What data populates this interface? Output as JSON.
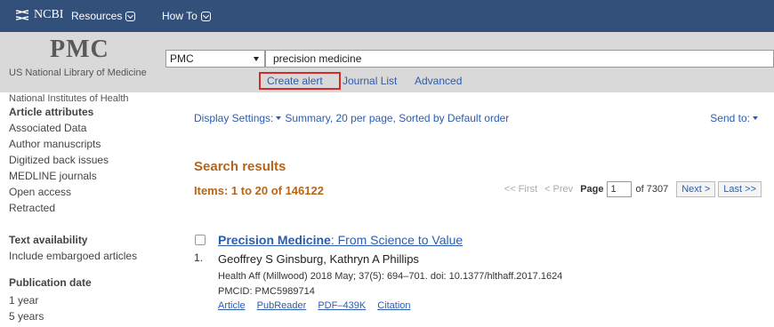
{
  "ncbi_bar": {
    "logo_text": "NCBI",
    "menu": [
      {
        "label": "Resources"
      },
      {
        "label": "How To"
      }
    ]
  },
  "header": {
    "logo": "PMC",
    "library_name": "US National Library of Medicine",
    "institute": "National Institutes of Health",
    "database_select": "PMC",
    "search_value": "precision medicine",
    "links": {
      "create_alert": "Create alert",
      "journal_list": "Journal List",
      "advanced": "Advanced"
    }
  },
  "sidebar": {
    "article_attributes": {
      "heading": "Article attributes",
      "items": [
        "Associated Data",
        "Author manuscripts",
        "Digitized back issues",
        "MEDLINE journals",
        "Open access",
        "Retracted"
      ]
    },
    "text_availability": {
      "heading": "Text availability",
      "items": [
        "Include embargoed articles"
      ]
    },
    "publication_date": {
      "heading": "Publication date",
      "items": [
        "1 year",
        "5 years"
      ]
    }
  },
  "main": {
    "display_settings_label": "Display Settings:",
    "display_settings_value": "Summary, 20 per page, Sorted by Default order",
    "send_to": "Send to:",
    "search_results_heading": "Search results",
    "items_count": "Items: 1 to 20 of 146122",
    "pager": {
      "first": "<< First",
      "prev": "< Prev",
      "page_label": "Page",
      "page_value": "1",
      "of_total": "of 7307",
      "next": "Next >",
      "last": "Last >>"
    },
    "results": [
      {
        "number": "1.",
        "title_highlight": "Precision Medicine",
        "title_rest": ": From Science to Value",
        "authors": "Geoffrey S Ginsburg, Kathryn A Phillips",
        "citation": "Health Aff (Millwood) 2018 May; 37(5): 694–701. doi: 10.1377/hlthaff.2017.1624",
        "pmcid": "PMCID: PMC5989714",
        "links": [
          "Article",
          "PubReader",
          "PDF–439K",
          "Citation"
        ]
      }
    ]
  },
  "colors": {
    "ncbi_bar": "#32507a",
    "header_bg": "#d9d9d9",
    "link": "#2a5db0",
    "heading_orange": "#b5661b",
    "highlight_box": "#d32a2a"
  }
}
